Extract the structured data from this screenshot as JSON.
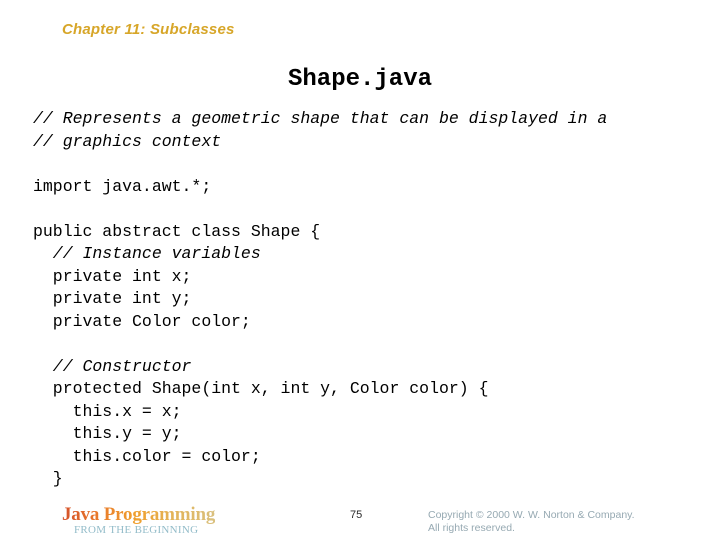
{
  "header": {
    "chapter": "Chapter 11: Subclasses",
    "chapter_color": "#d7a629"
  },
  "title": {
    "text": "Shape.java"
  },
  "code": {
    "language": "java",
    "lines": [
      {
        "text": "// Represents a geometric shape that can be displayed in a",
        "style": "comment"
      },
      {
        "text": "// graphics context",
        "style": "comment"
      },
      {
        "text": "",
        "style": "blank"
      },
      {
        "text": "import java.awt.*;",
        "style": "code"
      },
      {
        "text": "",
        "style": "blank"
      },
      {
        "text": "public abstract class Shape {",
        "style": "code"
      },
      {
        "text": "  // Instance variables",
        "style": "comment"
      },
      {
        "text": "  private int x;",
        "style": "code"
      },
      {
        "text": "  private int y;",
        "style": "code"
      },
      {
        "text": "  private Color color;",
        "style": "code"
      },
      {
        "text": "",
        "style": "blank"
      },
      {
        "text": "  // Constructor",
        "style": "comment"
      },
      {
        "text": "  protected Shape(int x, int y, Color color) {",
        "style": "code"
      },
      {
        "text": "    this.x = x;",
        "style": "code"
      },
      {
        "text": "    this.y = y;",
        "style": "code"
      },
      {
        "text": "    this.color = color;",
        "style": "code"
      },
      {
        "text": "  }",
        "style": "code"
      }
    ]
  },
  "footer": {
    "logo_title": "Java Programming",
    "logo_subtitle": "FROM THE BEGINNING",
    "page_number": "75",
    "copyright_line1": "Copyright © 2000 W. W. Norton & Company.",
    "copyright_line2": "All rights reserved.",
    "logo_gradient_start": "#d4512a",
    "logo_gradient_end": "#d9c07e",
    "subtitle_color": "#93bcc9",
    "copyright_color": "#96a9b2"
  }
}
